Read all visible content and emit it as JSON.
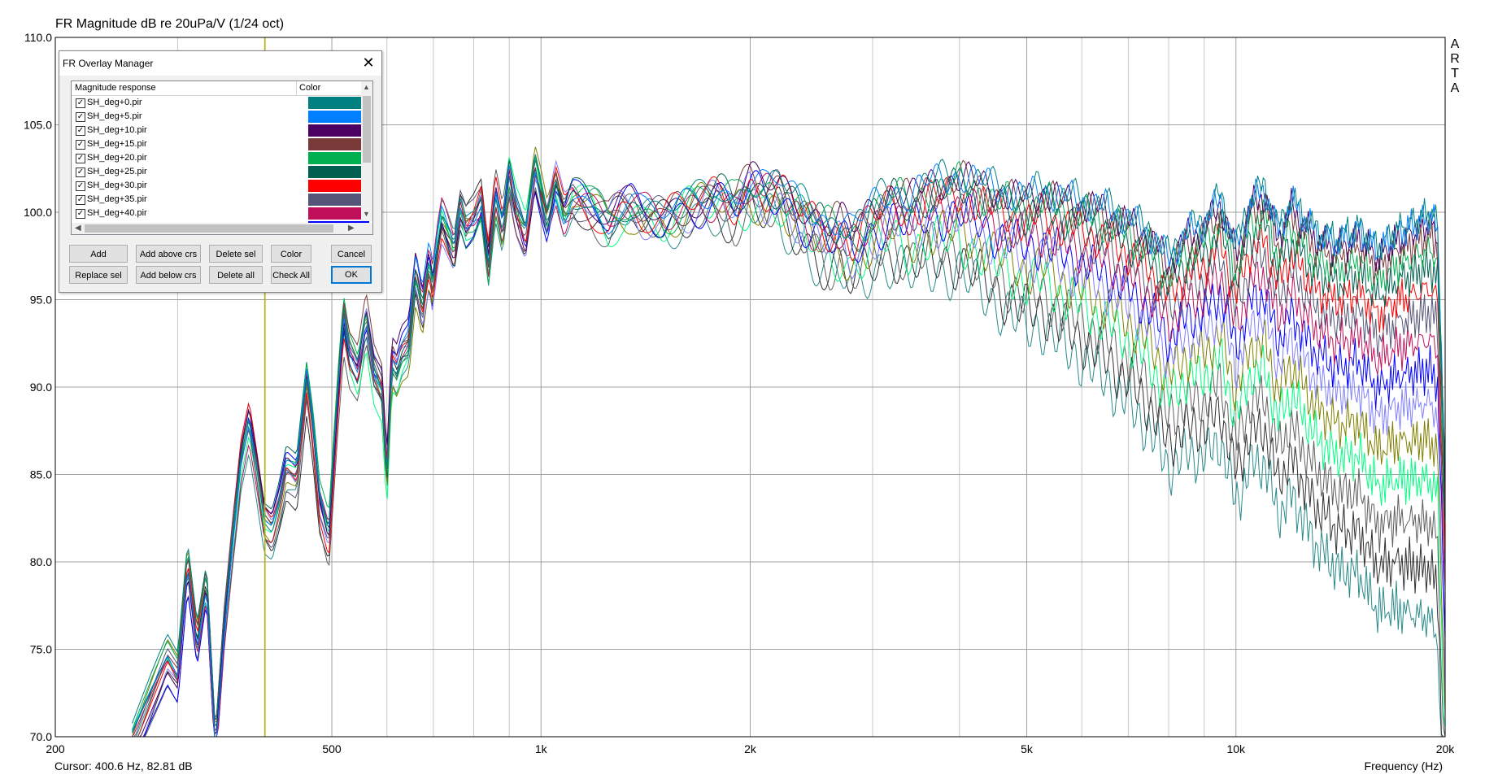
{
  "window": {
    "title": "FR Magnitude dB re 20uPa/V (1/24 oct)",
    "cursor_readout": "Cursor: 400.6 Hz, 82.81 dB",
    "brand_letters": [
      "A",
      "R",
      "T",
      "A"
    ]
  },
  "chart_data": {
    "type": "line",
    "title": "FR Magnitude dB re 20uPa/V (1/24 oct)",
    "xlabel": "Frequency (Hz)",
    "ylabel": "",
    "x_scale": "log",
    "xlim": [
      200,
      20000
    ],
    "ylim": [
      70,
      110
    ],
    "grid": true,
    "x_tick_labels": [
      {
        "value": 200,
        "label": "200"
      },
      {
        "value": 500,
        "label": "500"
      },
      {
        "value": 1000,
        "label": "1k"
      },
      {
        "value": 2000,
        "label": "2k"
      },
      {
        "value": 5000,
        "label": "5k"
      },
      {
        "value": 10000,
        "label": "10k"
      },
      {
        "value": 20000,
        "label": "20k"
      }
    ],
    "y_ticks": [
      70,
      75,
      80,
      85,
      90,
      95,
      100,
      105,
      110
    ],
    "y_tick_labels": [
      "70.0",
      "75.0",
      "80.0",
      "85.0",
      "90.0",
      "95.0",
      "100.0",
      "105.0",
      "110.0"
    ],
    "cursor_x": 400.6,
    "cursor_color": "#b5b500",
    "base_curve": {
      "x": [
        258,
        275,
        290,
        300,
        310,
        320,
        330,
        340,
        350,
        360,
        370,
        380,
        390,
        400,
        410,
        420,
        430,
        445,
        460,
        470,
        480,
        495,
        510,
        520,
        530,
        545,
        560,
        575,
        590,
        600,
        610,
        620,
        630,
        645,
        660,
        675,
        690,
        700,
        710,
        720,
        735,
        750,
        765,
        780,
        800,
        820,
        840,
        860,
        880,
        900,
        920,
        950,
        980,
        1000,
        1020,
        1050,
        1080,
        1110,
        1150,
        1200,
        1250,
        1300,
        1350,
        1400,
        1500,
        1600,
        1700,
        1800,
        1900,
        2000,
        2100,
        2200,
        2300,
        2400,
        2500,
        2600,
        2700,
        2800,
        3000,
        3200,
        3400,
        3600,
        3800,
        4000,
        4200,
        4500,
        4800,
        5000,
        5300,
        5600,
        6000,
        6400,
        7000,
        7500,
        8000,
        8500,
        9000,
        9500,
        10000,
        10500,
        11000,
        11500,
        12000,
        13000,
        14000,
        15000,
        16000,
        17000,
        18000,
        19000,
        19500,
        20000
      ],
      "y": [
        70.0,
        72.8,
        75.0,
        74.0,
        80.4,
        76.0,
        79.5,
        70.0,
        77.0,
        82.0,
        86.5,
        88.8,
        86.0,
        83.0,
        82.5,
        84.0,
        86.0,
        85.5,
        91.0,
        88.0,
        84.0,
        82.0,
        90.0,
        94.5,
        92.5,
        91.5,
        94.5,
        91.5,
        90.5,
        85.5,
        92.0,
        91.5,
        92.5,
        93.0,
        97.0,
        95.0,
        97.5,
        96.0,
        98.0,
        99.5,
        98.5,
        97.5,
        100.0,
        99.0,
        99.5,
        100.5,
        97.0,
        101.0,
        99.0,
        102.0,
        100.0,
        98.5,
        102.5,
        101.0,
        99.5,
        101.8,
        100.0,
        101.0,
        100.8,
        100.2,
        99.5,
        100.3,
        100.5,
        100.0,
        99.8,
        100.5,
        101.0,
        101.5,
        100.8,
        102.0,
        101.5,
        101.8,
        101.0,
        100.5,
        100.0,
        99.5,
        99.8,
        99.0,
        100.5,
        101.5,
        101.0,
        101.8,
        102.0,
        102.3,
        102.0,
        101.5,
        101.2,
        101.0,
        101.5,
        101.0,
        100.8,
        100.5,
        99.8,
        99.0,
        97.5,
        99.0,
        99.5,
        101.0,
        98.0,
        100.8,
        101.5,
        99.0,
        100.8,
        99.0,
        98.5,
        99.2,
        98.0,
        99.0,
        99.5,
        100.0,
        99.5,
        85.0
      ]
    },
    "series": [
      {
        "name": "SH_deg+0.pir",
        "color": "#008080"
      },
      {
        "name": "SH_deg+5.pir",
        "color": "#0080ff"
      },
      {
        "name": "SH_deg+10.pir",
        "color": "#4b0062"
      },
      {
        "name": "SH_deg+15.pir",
        "color": "#7b3a3a"
      },
      {
        "name": "SH_deg+20.pir",
        "color": "#00b050"
      },
      {
        "name": "SH_deg+25.pir",
        "color": "#006050"
      },
      {
        "name": "SH_deg+30.pir",
        "color": "#ff0000"
      },
      {
        "name": "SH_deg+35.pir",
        "color": "#555577"
      },
      {
        "name": "SH_deg+40.pir",
        "color": "#c0105a"
      },
      {
        "color": "#0000ff"
      },
      {
        "color": "#8080ff"
      },
      {
        "color": "#808000"
      },
      {
        "color": "#00ff80"
      },
      {
        "color": "#606060"
      },
      {
        "color": "#303030"
      },
      {
        "color": "#2a8a8a"
      }
    ]
  },
  "dialog": {
    "title": "FR Overlay Manager",
    "col_response": "Magnitude response",
    "col_color": "Color",
    "checkmark": "✓",
    "close_glyph": "✕",
    "items": [
      {
        "name": "SH_deg+0.pir",
        "checked": true,
        "color": "#008080"
      },
      {
        "name": "SH_deg+5.pir",
        "checked": true,
        "color": "#0080ff"
      },
      {
        "name": "SH_deg+10.pir",
        "checked": true,
        "color": "#4b0062"
      },
      {
        "name": "SH_deg+15.pir",
        "checked": true,
        "color": "#7b3a3a"
      },
      {
        "name": "SH_deg+20.pir",
        "checked": true,
        "color": "#00b050"
      },
      {
        "name": "SH_deg+25.pir",
        "checked": true,
        "color": "#006050"
      },
      {
        "name": "SH_deg+30.pir",
        "checked": true,
        "color": "#ff0000"
      },
      {
        "name": "SH_deg+35.pir",
        "checked": true,
        "color": "#555577"
      },
      {
        "name": "SH_deg+40.pir",
        "checked": true,
        "color": "#c0105a"
      }
    ],
    "next_row_color": "#0000ff",
    "buttons": {
      "add": "Add",
      "add_above": "Add above crs",
      "delete_sel": "Delete sel",
      "color": "Color",
      "cancel": "Cancel",
      "replace_sel": "Replace sel",
      "add_below": "Add below crs",
      "delete_all": "Delete all",
      "check_all": "Check All",
      "ok": "OK"
    }
  }
}
